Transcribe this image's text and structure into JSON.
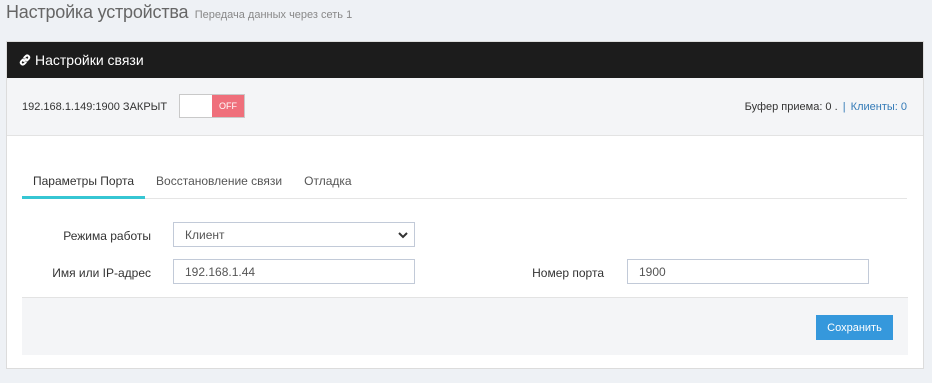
{
  "page": {
    "title": "Настройка устройства",
    "subtitle": "Передача данных через сеть 1"
  },
  "portlet": {
    "caption": "Настройки связи",
    "icon": "link-icon"
  },
  "status": {
    "connection_text": "192.168.1.149:1900 ЗАКРЫТ",
    "toggle_label": "OFF",
    "buffer_text": "Буфер приема: 0 .",
    "separator": "|",
    "clients_text": "Клиенты: 0"
  },
  "tabs": [
    {
      "label": "Параметры Порта",
      "active": true
    },
    {
      "label": "Восстановление связи",
      "active": false
    },
    {
      "label": "Отладка",
      "active": false
    }
  ],
  "form": {
    "mode_label": "Режима работы",
    "mode_value": "Клиент",
    "host_label": "Имя или IP-адрес",
    "host_value": "192.168.1.44",
    "port_label": "Номер порта",
    "port_value": "1900"
  },
  "footer": {
    "save_label": "Сохранить"
  },
  "colors": {
    "header_bg": "#1c1c1c",
    "toggle_off": "#ef6f7b",
    "tab_accent": "#36c6d3",
    "button_primary": "#3598dc",
    "link": "#337ab7"
  }
}
